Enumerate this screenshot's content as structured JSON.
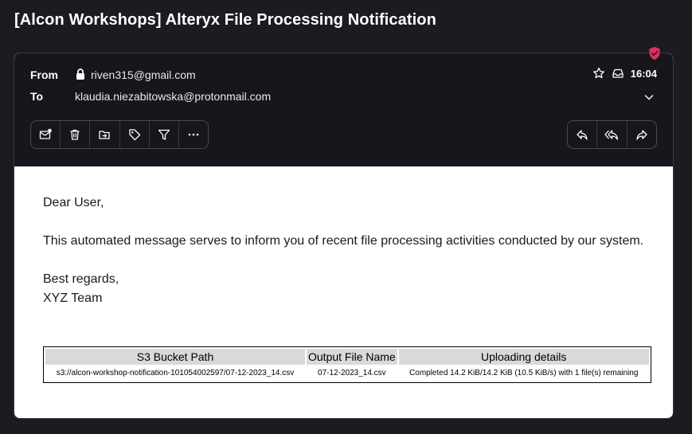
{
  "email": {
    "subject": "[Alcon Workshops] Alteryx File Processing Notification",
    "from_label": "From",
    "from_address": "riven315@gmail.com",
    "to_label": "To",
    "to_address": "klaudia.niezabitowska@protonmail.com",
    "time": "16:04",
    "body": {
      "greeting": "Dear User,",
      "paragraph": "This automated message serves to inform you of recent file processing activities conducted by our system.",
      "closing": "Best regards,",
      "signature": "XYZ Team"
    },
    "table": {
      "headers": [
        "S3 Bucket Path",
        "Output File Name",
        "Uploading details"
      ],
      "rows": [
        [
          "s3://alcon-workshop-notification-101054002597/07-12-2023_14.csv",
          "07-12-2023_14.csv",
          "Completed 14.2 KiB/14.2 KiB (10.5 KiB/s) with 1 file(s) remaining"
        ]
      ]
    }
  },
  "toolbar_left": [
    "mark-unread-icon",
    "trash-icon",
    "move-to-folder-icon",
    "label-icon",
    "filter-icon",
    "more-icon"
  ],
  "toolbar_right": [
    "reply-icon",
    "reply-all-icon",
    "forward-icon"
  ],
  "colors": {
    "background": "#1c1b22",
    "header": "#17161c",
    "badge": "#e02e5c"
  }
}
